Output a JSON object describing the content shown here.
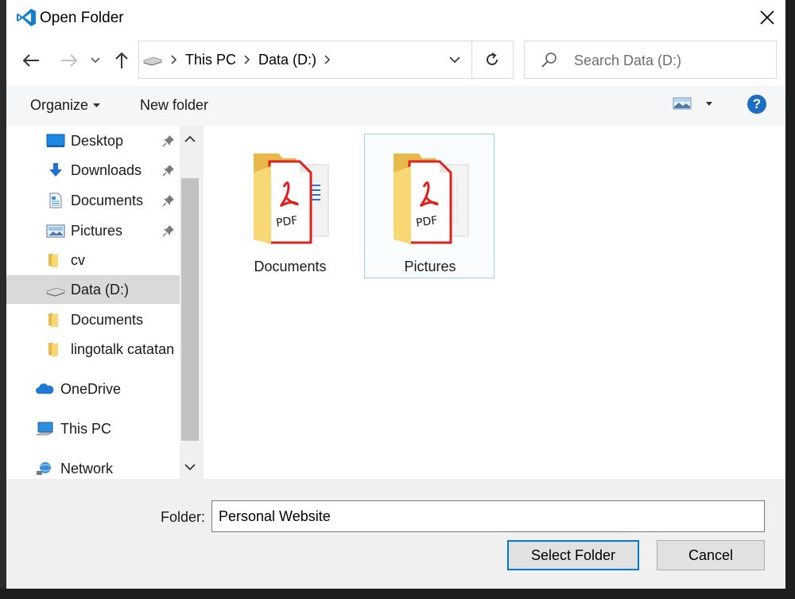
{
  "window": {
    "title": "Open Folder",
    "app_icon": "vscode-icon",
    "close_icon": "close-icon"
  },
  "navigation": {
    "back_icon": "arrow-left-icon",
    "forward_icon": "arrow-right-icon",
    "recent_icon": "chevron-down-icon",
    "up_icon": "arrow-up-icon"
  },
  "address": {
    "crumbs": [
      "This PC",
      "Data (D:)"
    ],
    "refresh_icon": "refresh-icon"
  },
  "search": {
    "placeholder": "Search Data (D:)"
  },
  "commands": {
    "organize": "Organize",
    "new_folder": "New folder"
  },
  "sidebar": {
    "items": [
      {
        "label": "Desktop",
        "icon": "desktop-icon",
        "pinned": true
      },
      {
        "label": "Downloads",
        "icon": "download-icon",
        "pinned": true
      },
      {
        "label": "Documents",
        "icon": "documents-icon",
        "pinned": true
      },
      {
        "label": "Pictures",
        "icon": "pictures-icon",
        "pinned": true
      },
      {
        "label": "cv",
        "icon": "folder-icon",
        "pinned": false
      },
      {
        "label": "Data (D:)",
        "icon": "drive-icon",
        "pinned": false,
        "selected": true
      },
      {
        "label": "Documents",
        "icon": "folder-icon",
        "pinned": false
      },
      {
        "label": "lingotalk catatan",
        "icon": "folder-icon",
        "pinned": false
      },
      {
        "label": "OneDrive",
        "icon": "onedrive-icon",
        "pinned": false
      },
      {
        "label": "This PC",
        "icon": "computer-icon",
        "pinned": false
      },
      {
        "label": "Network",
        "icon": "network-icon",
        "pinned": false
      }
    ]
  },
  "content": {
    "folders": [
      {
        "name": "Documents",
        "icon": "pdf-folder-icon",
        "selected": false
      },
      {
        "name": "Pictures",
        "icon": "pdf-folder-icon",
        "selected": true
      }
    ]
  },
  "footer": {
    "folder_label": "Folder:",
    "folder_value": "Personal Website",
    "select_button": "Select Folder",
    "cancel_button": "Cancel"
  },
  "colors": {
    "accent": "#0078d7",
    "selection": "#d9d9d9",
    "folder_yellow": "#f8d775",
    "pdf_red": "#e0201b"
  }
}
